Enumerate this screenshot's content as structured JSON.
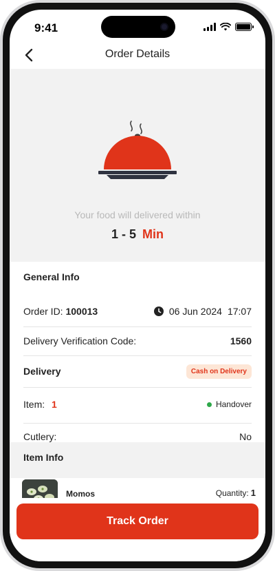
{
  "status_bar": {
    "time": "9:41"
  },
  "header": {
    "title": "Order Details",
    "back_icon": "chevron-left-icon"
  },
  "hero": {
    "icon": "food-cloche-icon",
    "eta_text": "Your food will delivered within",
    "eta_range": "1 - 5",
    "eta_unit": "Min"
  },
  "general_info": {
    "title": "General Info",
    "order_id_label": "Order ID:",
    "order_id": "100013",
    "clock_icon": "clock-icon",
    "date": "06 Jun 2024",
    "time": "17:07",
    "verification_label": "Delivery Verification Code:",
    "verification_code": "1560",
    "delivery_label": "Delivery",
    "payment_badge": "Cash on Delivery",
    "item_label": "Item:",
    "item_count": "1",
    "item_status": "Handover",
    "cutlery_label": "Cutlery:",
    "cutlery_value": "No"
  },
  "item_info": {
    "title": "Item Info",
    "items": [
      {
        "name": "Momos",
        "quantity_label": "Quantity:",
        "quantity": "1"
      }
    ]
  },
  "actions": {
    "track_order": "Track Order"
  },
  "colors": {
    "accent": "#e0341a",
    "badge_bg": "#fde6d6",
    "status_green": "#2ea84a",
    "section_bg": "#f2f2f2"
  }
}
